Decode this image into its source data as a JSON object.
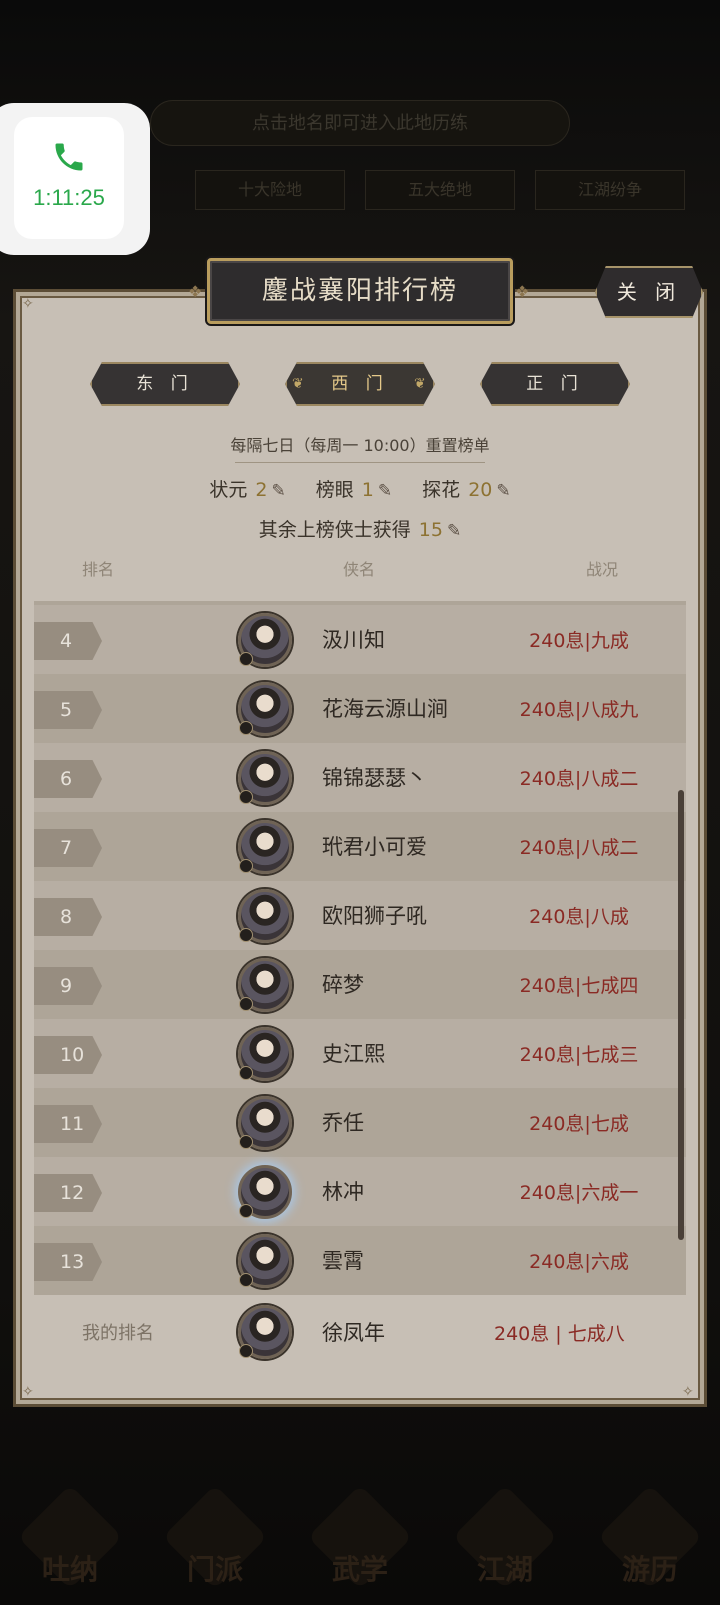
{
  "background": {
    "hint": "点击地名即可进入此地历练",
    "tabs": [
      "十大险地",
      "五大绝地",
      "江湖纷争"
    ],
    "nav": [
      "吐纳",
      "门派",
      "武学",
      "江湖",
      "游历"
    ]
  },
  "call": {
    "time": "1:11:25",
    "icon": "phone-icon"
  },
  "panel": {
    "title": "鏖战襄阳排行榜",
    "close_label": "关 闭",
    "gates": [
      {
        "label": "东 门",
        "active": false
      },
      {
        "label": "西 门",
        "active": true
      },
      {
        "label": "正 门",
        "active": false
      }
    ],
    "reset_text": "每隔七日（每周一 10:00）重置榜单",
    "rewards": {
      "first_label": "状元",
      "first_value": "2",
      "second_label": "榜眼",
      "second_value": "1",
      "third_label": "探花",
      "third_value": "20",
      "rest_label": "其余上榜侠士获得",
      "rest_value": "15"
    },
    "columns": {
      "rank": "排名",
      "name": "侠名",
      "status": "战况"
    },
    "rows": [
      {
        "rank": "4",
        "name": "汲川知",
        "status": "240息|九成"
      },
      {
        "rank": "5",
        "name": "花海云源山涧",
        "status": "240息|八成九"
      },
      {
        "rank": "6",
        "name": "锦锦瑟瑟丶",
        "status": "240息|八成二"
      },
      {
        "rank": "7",
        "name": "玳君小可爱",
        "status": "240息|八成二"
      },
      {
        "rank": "8",
        "name": "欧阳狮子吼",
        "status": "240息|八成"
      },
      {
        "rank": "9",
        "name": "碎梦",
        "status": "240息|七成四"
      },
      {
        "rank": "10",
        "name": "史江熙",
        "status": "240息|七成三"
      },
      {
        "rank": "11",
        "name": "乔任",
        "status": "240息|七成"
      },
      {
        "rank": "12",
        "name": "林冲",
        "status": "240息|六成一"
      },
      {
        "rank": "13",
        "name": "雲霄",
        "status": "240息|六成"
      }
    ],
    "my_rank": {
      "label": "我的排名",
      "name": "徐凤年",
      "status": "240息 | 七成八"
    }
  }
}
